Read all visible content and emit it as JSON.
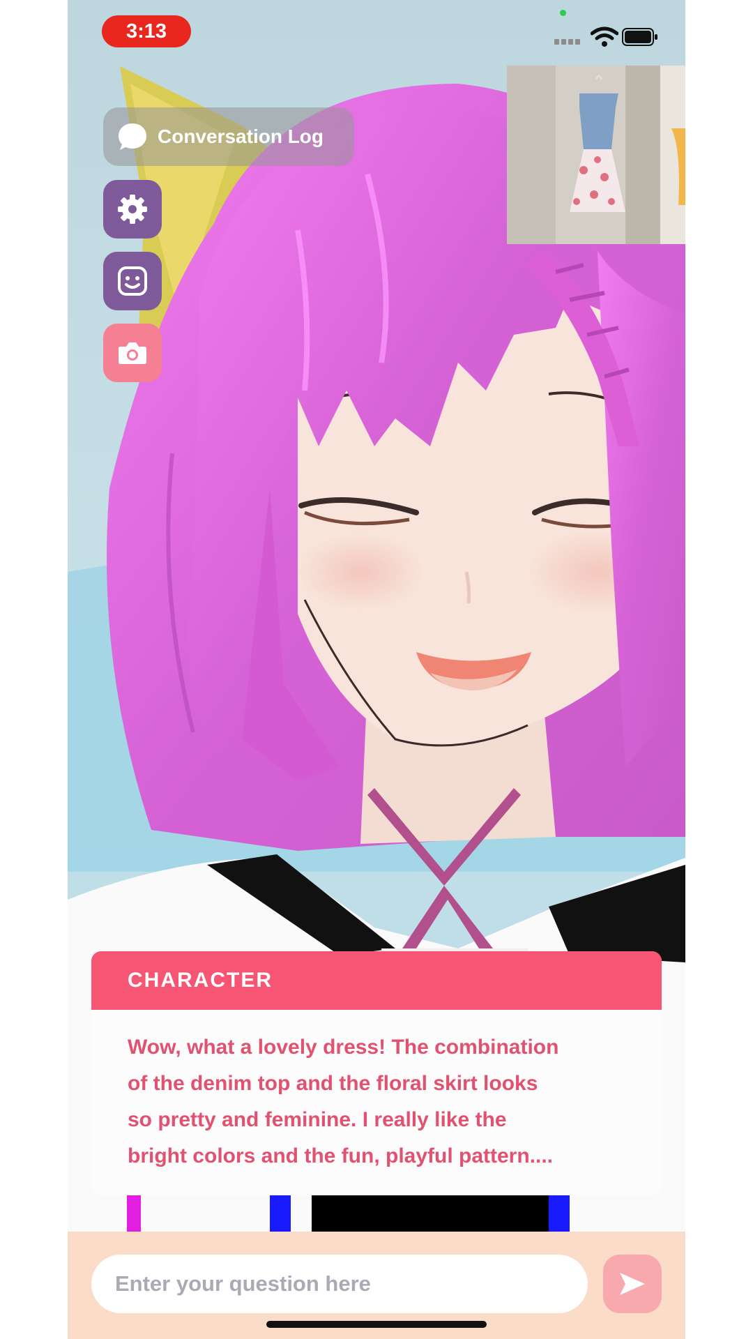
{
  "status_bar": {
    "time": "3:13"
  },
  "toolbar": {
    "conversation_log_label": "Conversation Log",
    "settings_icon": "gear-icon",
    "expression_icon": "smiley-face-icon",
    "camera_icon": "camera-icon"
  },
  "dialog": {
    "speaker": "CHARACTER",
    "line_1": "Wow, what a lovely dress! The combination",
    "line_2": "of the denim top and the floral skirt looks",
    "line_3": "so pretty and feminine. I really like the",
    "line_4": "bright colors and the fun, playful pattern...."
  },
  "input": {
    "placeholder": "Enter your question here"
  },
  "colors": {
    "accent_pink": "#f65674",
    "dialog_text": "#e05270",
    "hair": "#e070e0",
    "bottom_bar": "#fbdcc8",
    "button_purple": "#7e5a9b",
    "time_pill": "#e8281f"
  }
}
